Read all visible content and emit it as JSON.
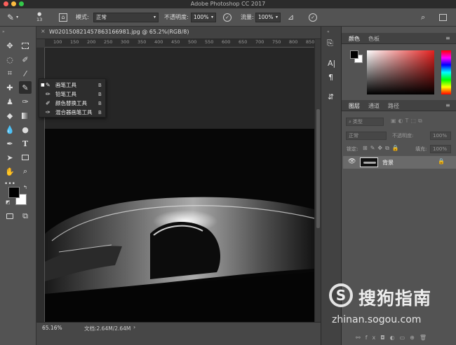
{
  "app": {
    "title": "Adobe Photoshop CC 2017"
  },
  "options_bar": {
    "brush_size": "13",
    "mode_label": "模式:",
    "mode_value": "正常",
    "opacity_label": "不透明度:",
    "opacity_value": "100%",
    "flow_label": "流量:",
    "flow_value": "100%"
  },
  "document": {
    "tab_title": "W020150821457863166981.jpg @ 65.2%(RGB/8)",
    "zoom": "65.16%",
    "doc_size": "文档:2.64M/2.64M"
  },
  "ruler": {
    "ticks": [
      "100",
      "150",
      "200",
      "250",
      "300",
      "350",
      "400",
      "450",
      "500",
      "550",
      "600",
      "650",
      "700",
      "750",
      "800",
      "850"
    ]
  },
  "brush_popup": {
    "items": [
      {
        "icon": "brush-icon",
        "label": "画笔工具",
        "shortcut": "B",
        "selected": true
      },
      {
        "icon": "pencil-icon",
        "label": "铅笔工具",
        "shortcut": "B",
        "selected": false
      },
      {
        "icon": "color-replace-icon",
        "label": "颜色替换工具",
        "shortcut": "B",
        "selected": false
      },
      {
        "icon": "mixer-brush-icon",
        "label": "混合器画笔工具",
        "shortcut": "B",
        "selected": false
      }
    ]
  },
  "color_panel": {
    "tabs": [
      "颜色",
      "色板"
    ],
    "colors": {
      "foreground": "#000000",
      "background": "#ffffff",
      "picked": "#e5211f"
    }
  },
  "layers_panel": {
    "tabs": [
      "图层",
      "通道",
      "路径"
    ],
    "filter_label": "类型",
    "blend_mode": "正常",
    "opacity_label": "不透明度:",
    "opacity_value": "100%",
    "lock_label": "锁定:",
    "fill_label": "填充:",
    "fill_value": "100%",
    "layer_name": "背景",
    "bottom_icons": [
      "link-icon",
      "fx-icon",
      "mask-icon",
      "adjustment-icon",
      "folder-icon",
      "new-layer-icon",
      "trash-icon"
    ]
  },
  "watermark": {
    "brand": "搜狗指南",
    "url": "zhinan.sogou.com"
  }
}
